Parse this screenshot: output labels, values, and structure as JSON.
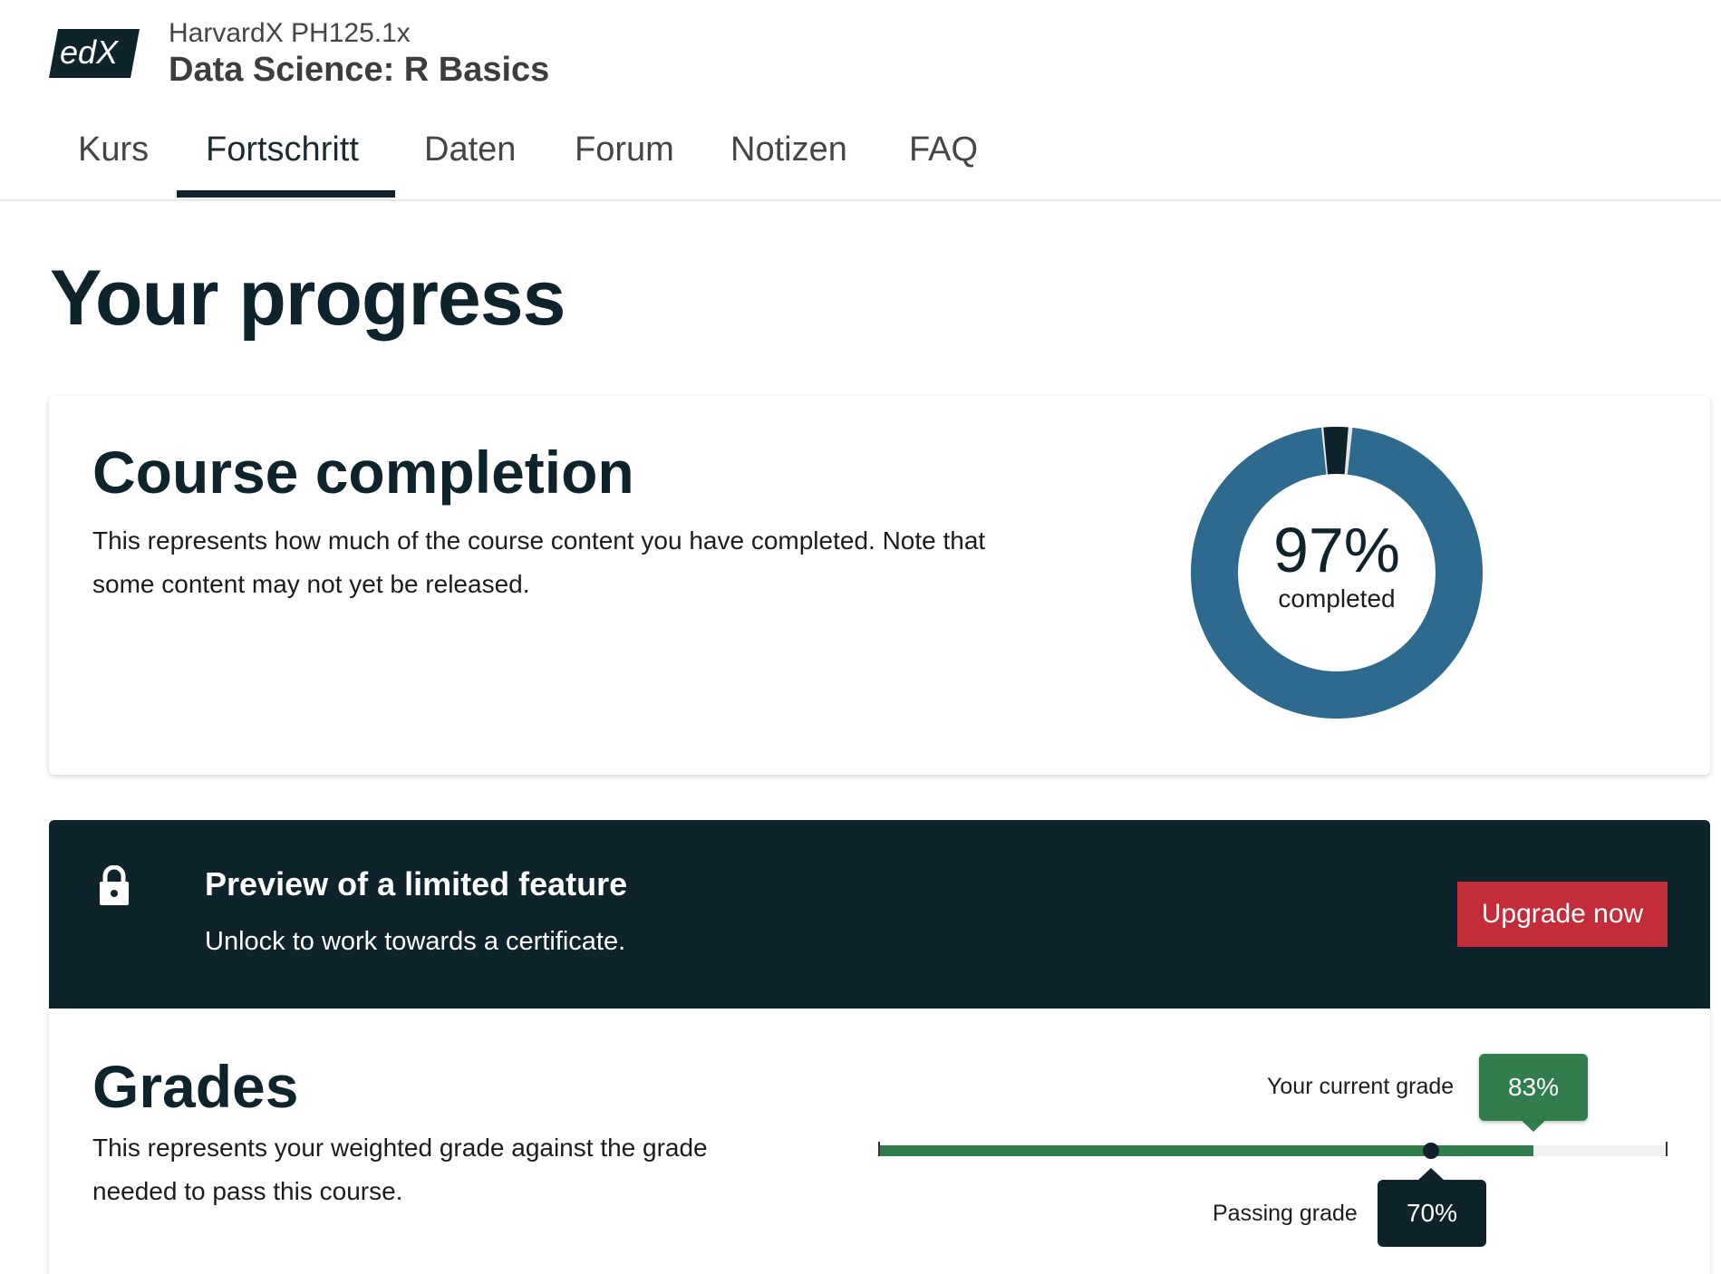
{
  "brand": {
    "logo_text": "edX"
  },
  "course": {
    "org_code": "HarvardX PH125.1x",
    "title": "Data Science: R Basics"
  },
  "tabs": [
    {
      "label": "Kurs"
    },
    {
      "label": "Fortschritt",
      "active": true
    },
    {
      "label": "Daten"
    },
    {
      "label": "Forum"
    },
    {
      "label": "Notizen"
    },
    {
      "label": "FAQ"
    }
  ],
  "page_title": "Your progress",
  "completion": {
    "heading": "Course completion",
    "description": "This represents how much of the course content you have completed. Note that some content may not yet be released.",
    "percent": 97,
    "percent_text": "97%",
    "caption": "completed",
    "colors": {
      "complete": "#2d6a8e",
      "incomplete": "#0e232b"
    }
  },
  "locked_banner": {
    "title": "Preview of a limited feature",
    "subtitle": "Unlock to work towards a certificate.",
    "button_label": "Upgrade now",
    "icon": "lock-icon",
    "button_color": "#c32d3a"
  },
  "grades": {
    "heading": "Grades",
    "description": "This represents your weighted grade against the grade needed to pass this course.",
    "current_label": "Your current grade",
    "current_text": "83%",
    "current_value": 0.83,
    "passing_label": "Passing grade",
    "passing_text": "70%",
    "passing_value": 0.7,
    "colors": {
      "fill": "#317d4e",
      "track": "#f0f0f0"
    }
  }
}
